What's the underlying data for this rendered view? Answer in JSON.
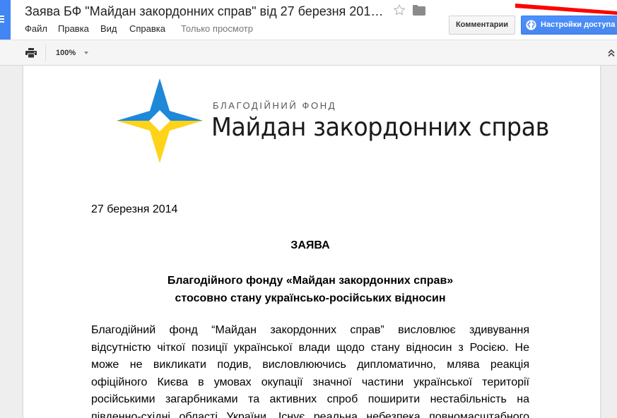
{
  "header": {
    "doc_title": "Заява БФ \"Майдан закордонних справ\" від 27 березня 201…",
    "menu": [
      "Файл",
      "Правка",
      "Вид",
      "Справка"
    ],
    "view_only": "Только просмотр",
    "comments_label": "Комментарии",
    "share_label": "Настройки доступа"
  },
  "toolbar": {
    "zoom": "100%"
  },
  "document": {
    "logo_subtitle": "БЛАГОДІЙНИЙ ФОНД",
    "logo_title": "Майдан закордонних справ",
    "date": "27 березня 2014",
    "heading": "ЗАЯВА",
    "subheading": [
      "Благодійного фонду «Майдан закордонних справ»",
      "стосовно стану українсько-російських відносин"
    ],
    "body_lines": [
      "Благодійний фонд “Майдан закордонних справ” висловлює здивування",
      "відсутністю чіткої позиції української влади щодо стану відносин з Росією. Не",
      "може не викликати подив, висловлюючись дипломатично, млява реакція",
      "офіційного Києва в умовах окупації значної частини української території",
      "російськими загарбниками та активних спроб поширити нестабільність на",
      "південно-східні області України. Існує реальна небезпека повномасштабного"
    ]
  },
  "colors": {
    "logo_blue": "#1e88d9",
    "logo_yellow": "#ffd31a",
    "share_button": "#4787ed",
    "app_tab": "#4285f4",
    "annotation": "#ff0000"
  },
  "icons": [
    "menu-icon",
    "star-icon",
    "folder-icon",
    "globe-icon",
    "print-icon",
    "chevron-down-icon",
    "collapse-icon"
  ]
}
